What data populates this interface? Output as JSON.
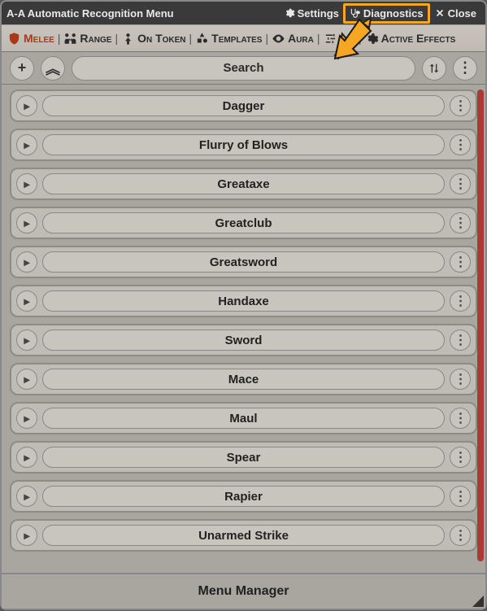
{
  "titlebar": {
    "title": "A-A Automatic Recognition Menu",
    "settings": "Settings",
    "diagnostics": "Diagnostics",
    "close": "Close"
  },
  "tabs": {
    "melee": "Melee",
    "range": "Range",
    "ontoken": "On Token",
    "templates": "Templates",
    "aura": "Aura",
    "preset": "Preset",
    "activeeffects": "Active Effects"
  },
  "toolbar": {
    "add": "+",
    "collapse": "︽",
    "search_placeholder": "Search",
    "sort": "⇅",
    "more": "⋮"
  },
  "items": [
    {
      "label": "Dagger"
    },
    {
      "label": "Flurry of Blows"
    },
    {
      "label": "Greataxe"
    },
    {
      "label": "Greatclub"
    },
    {
      "label": "Greatsword"
    },
    {
      "label": "Handaxe"
    },
    {
      "label": "Sword"
    },
    {
      "label": "Mace"
    },
    {
      "label": "Maul"
    },
    {
      "label": "Spear"
    },
    {
      "label": "Rapier"
    },
    {
      "label": "Unarmed Strike"
    }
  ],
  "footer": {
    "label": "Menu Manager"
  }
}
